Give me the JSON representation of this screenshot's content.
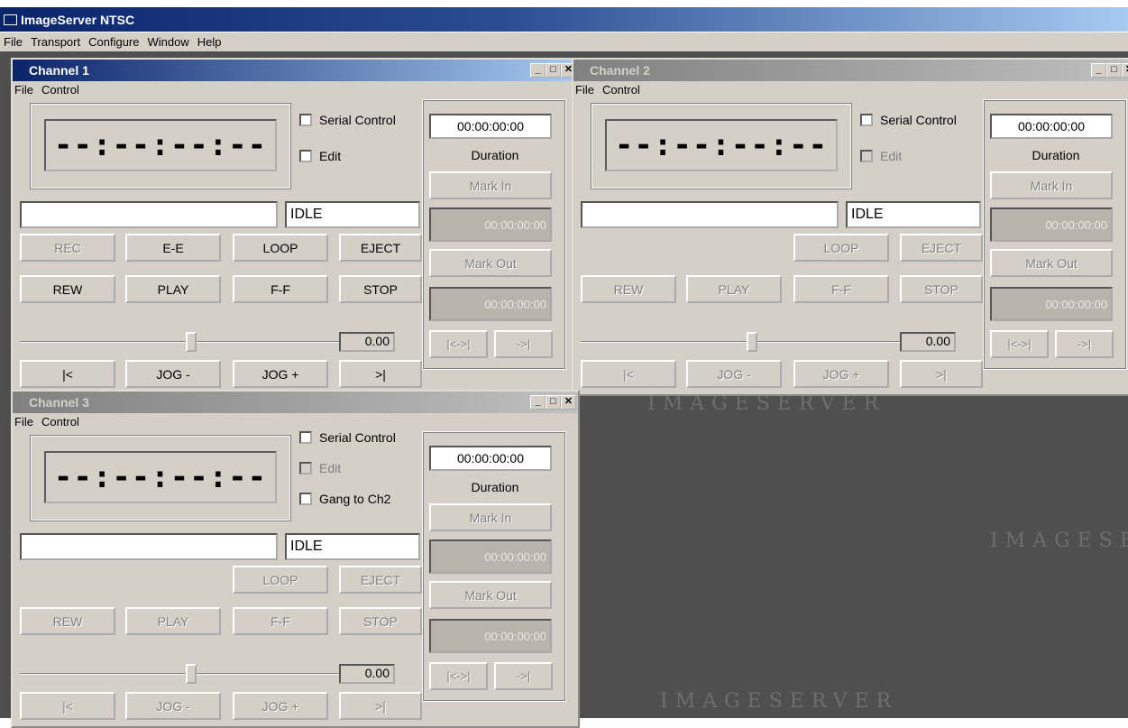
{
  "app": {
    "title": "ImageServer NTSC",
    "menu": [
      "File",
      "Transport",
      "Configure",
      "Window",
      "Help"
    ]
  },
  "watermark": "IMAGESERVER",
  "watermark_right": "IMAGESE",
  "channels": [
    {
      "title": "Channel 1",
      "menu": [
        "File",
        "Control"
      ],
      "timecode": "--:--:--:--",
      "serial_control": "Serial Control",
      "edit": "Edit",
      "gang": "",
      "clip_name": "",
      "status": "IDLE",
      "btn_row1": [
        "REC",
        "E-E",
        "LOOP",
        "EJECT"
      ],
      "btn_row2": [
        "REW",
        "PLAY",
        "F-F",
        "STOP"
      ],
      "btn_row3": [
        "|<",
        "JOG -",
        "JOG +",
        ">|"
      ],
      "slider_value": "0.00",
      "duration_value": "00:00:00:00",
      "duration_label": "Duration",
      "mark_in": "Mark In",
      "mark_in_value": "00:00:00:00",
      "mark_out": "Mark Out",
      "mark_out_value": "00:00:00:00",
      "small_btns": [
        "|<->|",
        "->|"
      ]
    },
    {
      "title": "Channel 2",
      "menu": [
        "File",
        "Control"
      ],
      "timecode": "--:--:--:--",
      "serial_control": "Serial Control",
      "edit": "Edit",
      "gang": "",
      "clip_name": "",
      "status": "IDLE",
      "btn_row1": [
        "",
        "",
        "LOOP",
        "EJECT"
      ],
      "btn_row2": [
        "REW",
        "PLAY",
        "F-F",
        "STOP"
      ],
      "btn_row3": [
        "|<",
        "JOG -",
        "JOG +",
        ">|"
      ],
      "slider_value": "0.00",
      "duration_value": "00:00:00:00",
      "duration_label": "Duration",
      "mark_in": "Mark In",
      "mark_in_value": "00:00:00:00",
      "mark_out": "Mark Out",
      "mark_out_value": "00:00:00:00",
      "small_btns": [
        "|<->|",
        "->|"
      ]
    },
    {
      "title": "Channel 3",
      "menu": [
        "File",
        "Control"
      ],
      "timecode": "--:--:--:--",
      "serial_control": "Serial Control",
      "edit": "Edit",
      "gang": "Gang to Ch2",
      "clip_name": "",
      "status": "IDLE",
      "btn_row1": [
        "",
        "",
        "LOOP",
        "EJECT"
      ],
      "btn_row2": [
        "REW",
        "PLAY",
        "F-F",
        "STOP"
      ],
      "btn_row3": [
        "|<",
        "JOG -",
        "JOG +",
        ">|"
      ],
      "slider_value": "0.00",
      "duration_value": "00:00:00:00",
      "duration_label": "Duration",
      "mark_in": "Mark In",
      "mark_in_value": "00:00:00:00",
      "mark_out": "Mark Out",
      "mark_out_value": "00:00:00:00",
      "small_btns": [
        "|<->|",
        "->|"
      ]
    }
  ]
}
